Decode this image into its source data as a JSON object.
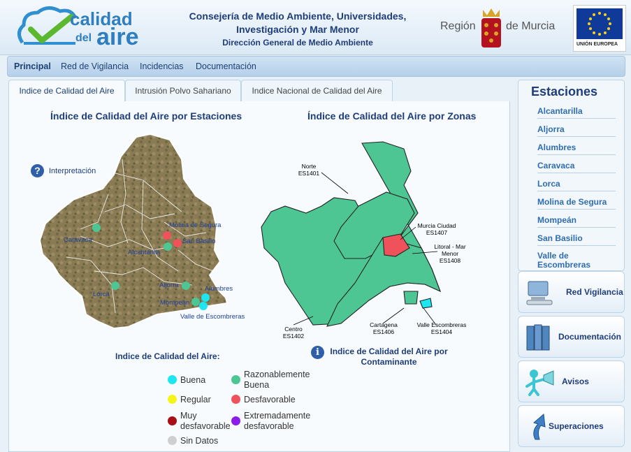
{
  "header": {
    "logo_line1": "calidad",
    "logo_line2a": "del",
    "logo_line2b": "aire",
    "ministry_line1": "Consejería de Medio Ambiente, Universidades,",
    "ministry_line2": "Investigación y Mar Menor",
    "ministry_line3": "Dirección General de Medio Ambiente",
    "region_a": "Región",
    "region_b": "de Murcia",
    "eu_label": "UNIÓN EUROPEA"
  },
  "nav": [
    "Principal",
    "Red de Vigilancia",
    "Incidencias",
    "Documentación"
  ],
  "tabs": [
    "Indice de Calidad del Aire",
    "Intrusión Polvo Sahariano",
    "Indice Nacional de Calidad del Aire"
  ],
  "left_map": {
    "title": "Índice de Calidad del Aire por Estaciones",
    "interpretation": "Interpretación",
    "stations": [
      {
        "name": "Caravaca",
        "status": "Razonablemente Buena"
      },
      {
        "name": "Molina de Segura",
        "status": "Desfavorable"
      },
      {
        "name": "San Basilio",
        "status": "Desfavorable"
      },
      {
        "name": "Alcantarilla",
        "status": "Razonablemente Buena"
      },
      {
        "name": "Lorca",
        "status": "Razonablemente Buena"
      },
      {
        "name": "Aljorra",
        "status": "Razonablemente Buena"
      },
      {
        "name": "Alumbres",
        "status": "Buena"
      },
      {
        "name": "Mompeán",
        "status": "Razonablemente Buena"
      },
      {
        "name": "Valle de Escombreras",
        "status": "Buena"
      }
    ]
  },
  "right_map": {
    "title": "Índice de Calidad del Aire por Zonas",
    "zones": [
      {
        "name": "Norte",
        "code": "ES1401"
      },
      {
        "name": "Murcia Ciudad",
        "code": "ES1407"
      },
      {
        "name": "Litoral - Mar Menor",
        "code": "ES1408"
      },
      {
        "name": "Centro",
        "code": "ES1402"
      },
      {
        "name": "Cartagena",
        "code": "ES1406"
      },
      {
        "name": "Valle Escombreras",
        "code": "ES1404"
      }
    ],
    "pollutant_link": "Indice de Calidad del Aire por Contaminante"
  },
  "legend": {
    "title": "Indice de Calidad del Aire:",
    "items": [
      {
        "label": "Buena",
        "color": "#1de6f0"
      },
      {
        "label": "Razonablemente Buena",
        "color": "#4dc693"
      },
      {
        "label": "Regular",
        "color": "#f5f51a"
      },
      {
        "label": "Desfavorable",
        "color": "#f0525c"
      },
      {
        "label": "Muy desfavorable",
        "color": "#a80e16"
      },
      {
        "label": "Extremadamente desfavorable",
        "color": "#8e1ce8"
      },
      {
        "label": "Sin Datos",
        "color": "#cfcfcf"
      }
    ]
  },
  "sidebar": {
    "title": "Estaciones",
    "stations": [
      "Alcantarilla",
      "Aljorra",
      "Alumbres",
      "Caravaca",
      "Lorca",
      "Molina de Segura",
      "Mompeán",
      "San Basilio",
      "Valle de Escombreras"
    ],
    "buttons": [
      "Red Vigilancia",
      "Documentación",
      "Avisos",
      "Superaciones"
    ]
  },
  "colors": {
    "good": "#1de6f0",
    "fair": "#4dc693",
    "bad": "#f0525c",
    "brand": "#1e3d7a"
  }
}
